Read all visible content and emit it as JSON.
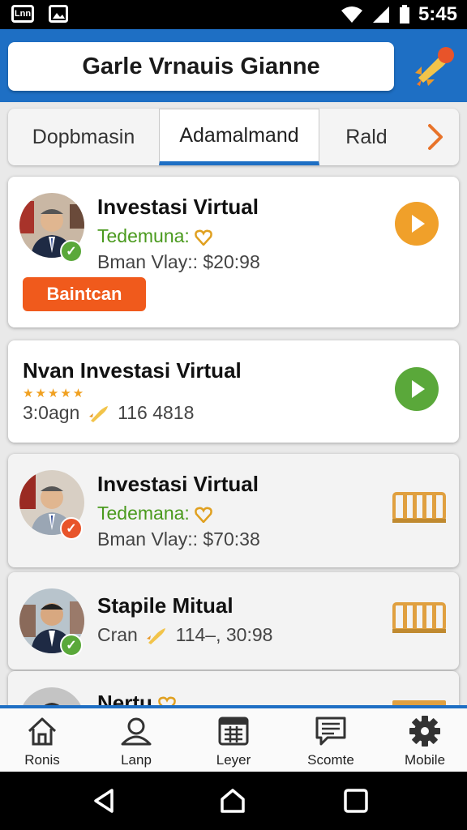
{
  "status_bar": {
    "left_icon_text": "Lnn",
    "time": "5:45"
  },
  "header": {
    "title": "Garle Vrnauis Gianne",
    "rocket_icon": "rocket-icon"
  },
  "tabs": [
    {
      "label": "Dopbmasin"
    },
    {
      "label": "Adamalmand"
    },
    {
      "label": "Rald"
    }
  ],
  "cards": [
    {
      "title": "Investasi Virtual",
      "subtitle": "Tedemuna:",
      "price": "Bman Vlay:: $20:98",
      "button": "Baintcan"
    },
    {
      "title": "Nvan Investasi Virtual",
      "stars": "★★★★★",
      "meta_left": "3:0agn",
      "meta_right": "116 4818"
    },
    {
      "title": "Investasi Virtual",
      "subtitle": "Tedemana:",
      "price": "Bman Vlay:: $70:38"
    },
    {
      "title": "Stapile Mitual",
      "meta_left": "Cran",
      "meta_right": "114‒, 30:98"
    },
    {
      "title": "Nertu"
    }
  ],
  "bottom_nav": [
    {
      "label": "Ronis",
      "icon": "house-icon"
    },
    {
      "label": "Lanp",
      "icon": "user-icon"
    },
    {
      "label": "Leyer",
      "icon": "calendar-icon"
    },
    {
      "label": "Scomte",
      "icon": "chat-icon"
    },
    {
      "label": "Mobile",
      "icon": "gear-icon"
    }
  ],
  "colors": {
    "primary": "#1e6fc4",
    "accent_orange": "#f05a1c",
    "play_orange": "#f0a02a",
    "play_green": "#5aa83a",
    "sub_green": "#4a9a1e"
  }
}
